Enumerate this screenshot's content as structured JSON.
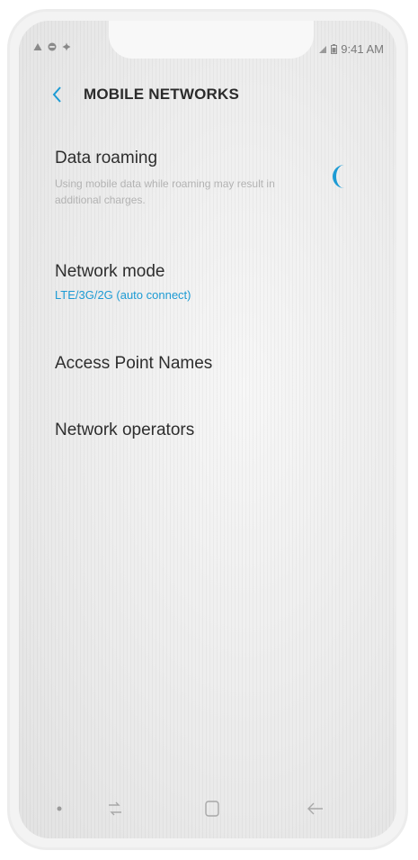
{
  "status_bar": {
    "left_icons": [
      "warning-icon",
      "dnd-icon",
      "gear-icon"
    ],
    "right_icons": [
      "wifi-icon",
      "battery-icon"
    ],
    "time": "9:41 AM"
  },
  "header": {
    "back_icon": "back-chevron-icon",
    "title": "MOBILE NETWORKS"
  },
  "settings": {
    "data_roaming": {
      "label": "Data roaming",
      "description": "Using mobile data while roaming may result in additional charges.",
      "toggle_on": true
    },
    "network_mode": {
      "label": "Network mode",
      "value": "LTE/3G/2G (auto connect)"
    },
    "access_point_names": {
      "label": "Access Point Names"
    },
    "network_operators": {
      "label": "Network operators"
    }
  },
  "nav_bar": {
    "icons": [
      "dot-icon",
      "recents-icon",
      "home-icon",
      "back-icon"
    ]
  },
  "colors": {
    "accent": "#1d9bd4",
    "text_primary": "#2e2e2e",
    "text_secondary": "#b3b3b3"
  }
}
